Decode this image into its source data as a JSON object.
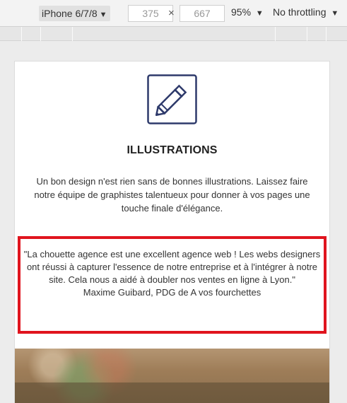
{
  "toolbar": {
    "device": "iPhone 6/7/8",
    "width": "375",
    "height": "667",
    "times": "×",
    "zoom": "95%",
    "throttling": "No throttling"
  },
  "section": {
    "icon": "pencil-icon",
    "title": "ILLUSTRATIONS",
    "description": "Un bon design n'est rien sans de bonnes illustrations. Laissez faire notre équipe de graphistes talentueux pour donner à vos pages une touche finale d'élégance."
  },
  "testimonial": {
    "quote": "\"La chouette agence est une excellent agence web ! Les webs designers ont réussi à capturer l'essence de notre entreprise et à l'intégrer à notre site. Cela nous a aidé à doubler nos ventes en ligne à Lyon.\"",
    "author": "Maxime Guibard, PDG de A vos fourchettes",
    "highlight_color": "#e0141e"
  },
  "colors": {
    "icon_stroke": "#2e3a6b",
    "page_background": "#ffffff"
  }
}
